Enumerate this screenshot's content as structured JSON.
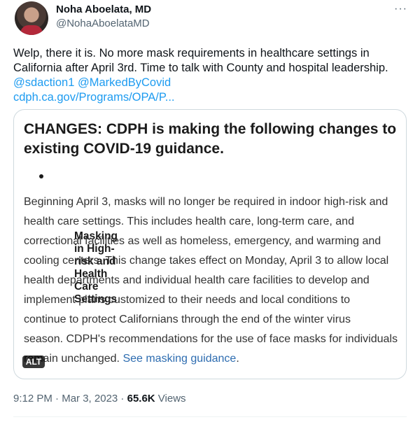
{
  "author": {
    "name": "Noha Aboelata, MD",
    "handle": "@NohaAboelataMD"
  },
  "more_label": "···",
  "tweet": {
    "line1": "Welp, there it is. No more mask requirements in healthcare settings in",
    "line2": "California after April 3rd. Time to talk with County and hospital leadership.",
    "mention1": "@sdaction1",
    "mention2": "@MarkedByCovid",
    "url": "cdph.ca.gov/Programs/OPA/P..."
  },
  "card": {
    "title": "CHANGES: CDPH is making the following changes to existing COVID-19 guidance.",
    "bullet": "Masking in High-risk and Health Care Settings",
    "body_lines": [
      "Beginning April 3, masks will no longer be required in indoor high-risk and",
      "health care settings. This includes health care, long-term care, and",
      "correctional facilities as well as homeless, emergency, and warming and",
      "cooling centers. This change takes effect on Monday, April 3 to allow local",
      "health departments and individual health care facilities to develop and",
      "implement plans customized to their needs and local conditions to",
      "continue to protect Californians through the end of the winter virus",
      "season. CDPH's recommendations for the use of face masks for individuals"
    ],
    "last_line": "remain unchanged.",
    "link": "See masking guidance",
    "link_suffix": ".",
    "alt_label": "ALT"
  },
  "meta": {
    "time": "9:12 PM",
    "sep1": " · ",
    "date": "Mar 3, 2023",
    "sep2": " · ",
    "views": "65.6K",
    "views_label": " Views"
  }
}
